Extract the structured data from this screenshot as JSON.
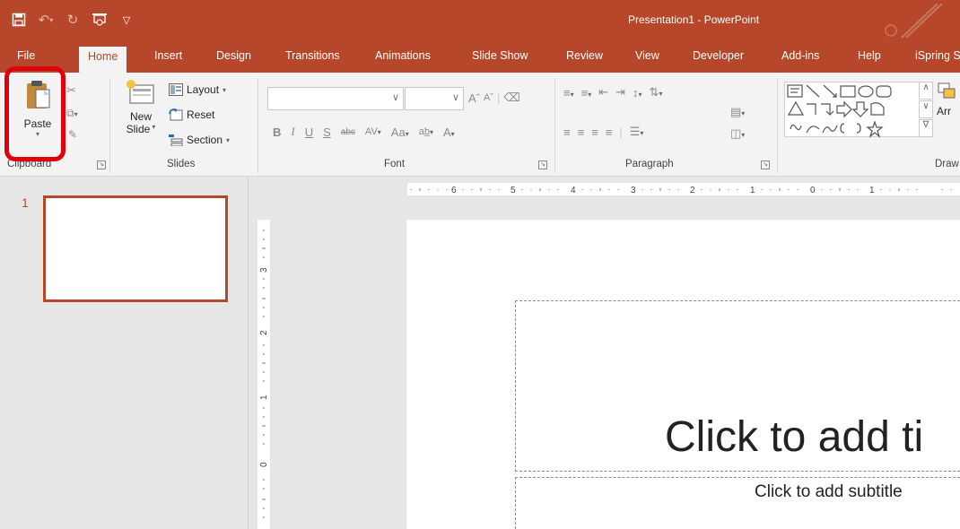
{
  "window": {
    "title": "Presentation1  -  PowerPoint",
    "accent": "#b7472a"
  },
  "qat": {
    "icons": [
      "save-icon",
      "undo-icon",
      "redo-icon",
      "start-from-beginning-icon",
      "customize-qat-icon"
    ]
  },
  "tabs": [
    "File",
    "Home",
    "Insert",
    "Design",
    "Transitions",
    "Animations",
    "Slide Show",
    "Review",
    "View",
    "Developer",
    "Add-ins",
    "Help",
    "iSpring S"
  ],
  "active_tab": "Home",
  "ribbon": {
    "clipboard": {
      "label": "Clipboard",
      "paste": "Paste"
    },
    "slides": {
      "label": "Slides",
      "new_slide_line1": "New",
      "new_slide_line2": "Slide",
      "layout": "Layout",
      "reset": "Reset",
      "section": "Section"
    },
    "font": {
      "label": "Font",
      "bold": "B",
      "italic": "I",
      "underline": "U",
      "shadow": "S",
      "strike": "abc",
      "change_case": "Aa",
      "font_color": "A"
    },
    "paragraph": {
      "label": "Paragraph"
    },
    "drawing": {
      "label": "Draw",
      "arrange": "Arr"
    }
  },
  "slides_pane": {
    "items": [
      {
        "number": "1"
      }
    ]
  },
  "rulers": {
    "horizontal_numbers": [
      "6",
      "5",
      "4",
      "3",
      "2",
      "1",
      "0",
      "1"
    ],
    "vertical_numbers": [
      "3",
      "2",
      "1",
      "0"
    ]
  },
  "slide": {
    "title_placeholder": "Click to add ti",
    "subtitle_placeholder": "Click to add subtitle"
  }
}
